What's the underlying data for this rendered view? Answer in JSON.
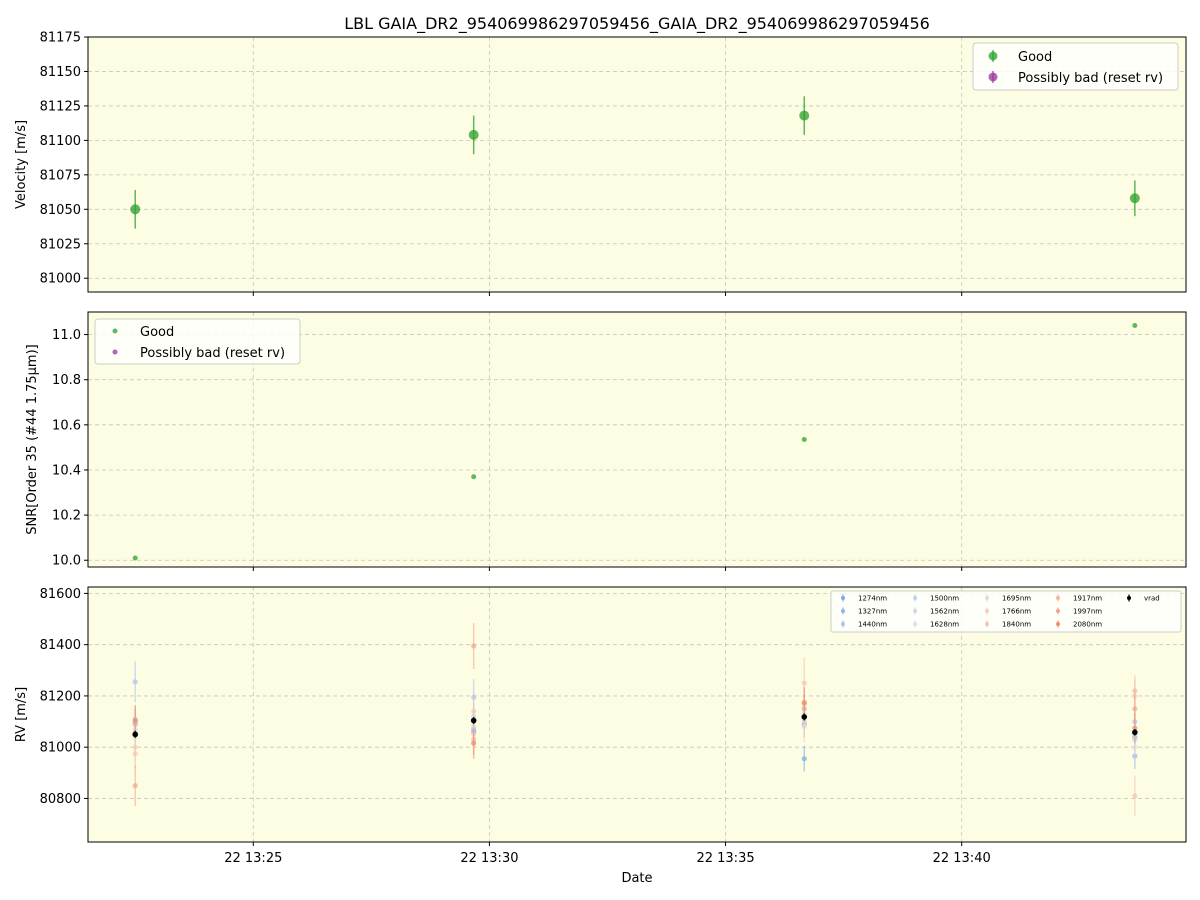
{
  "chart_data": [
    {
      "type": "scatter",
      "title": "LBL GAIA_DR2_954069986297059456_GAIA_DR2_954069986297059456",
      "xlabel": "",
      "ylabel": "Velocity [m/s]",
      "ylim": [
        80990,
        81175
      ],
      "yticks": [
        81000,
        81025,
        81050,
        81075,
        81100,
        81125,
        81150,
        81175
      ],
      "ytick_labels": [
        "81000",
        "81025",
        "81050",
        "81075",
        "81100",
        "81125",
        "81150",
        "81175"
      ],
      "grid": true,
      "legend": "top-right",
      "legend_entries": [
        {
          "label": "Good",
          "color": "#2ca02c"
        },
        {
          "label": "Possibly bad (reset rv)",
          "color": "#9b2f9b"
        }
      ],
      "series": [
        {
          "name": "Good",
          "color": "#2ca02c",
          "points": [
            {
              "x": "13:22:30",
              "y": 81050,
              "err": 14
            },
            {
              "x": "13:29:40",
              "y": 81104,
              "err": 14
            },
            {
              "x": "13:36:40",
              "y": 81118,
              "err": 14
            },
            {
              "x": "13:43:40",
              "y": 81058,
              "err": 13
            }
          ]
        },
        {
          "name": "Possibly bad (reset rv)",
          "color": "#9b2f9b",
          "points": []
        }
      ]
    },
    {
      "type": "scatter",
      "xlabel": "",
      "ylabel": "SNR[Order 35 (#44 1.75μm)]",
      "ylim": [
        9.97,
        11.1
      ],
      "yticks": [
        10.0,
        10.2,
        10.4,
        10.6,
        10.8,
        11.0
      ],
      "ytick_labels": [
        "10.0",
        "10.2",
        "10.4",
        "10.6",
        "10.8",
        "11.0"
      ],
      "grid": true,
      "legend": "top-left",
      "legend_entries": [
        {
          "label": "Good",
          "color": "#2ca02c"
        },
        {
          "label": "Possibly bad (reset rv)",
          "color": "#9b2f9b"
        }
      ],
      "series": [
        {
          "name": "Good",
          "color": "#2ca02c",
          "points": [
            {
              "x": "13:22:30",
              "y": 10.01
            },
            {
              "x": "13:29:40",
              "y": 10.37
            },
            {
              "x": "13:36:40",
              "y": 10.535
            },
            {
              "x": "13:43:40",
              "y": 11.04
            }
          ]
        },
        {
          "name": "Possibly bad (reset rv)",
          "color": "#9b2f9b",
          "points": []
        }
      ]
    },
    {
      "type": "scatter",
      "xlabel": "Date",
      "ylabel": "RV [m/s]",
      "ylim": [
        80630,
        81625
      ],
      "yticks": [
        80800,
        81000,
        81200,
        81400,
        81600
      ],
      "ytick_labels": [
        "80800",
        "81000",
        "81200",
        "81400",
        "81600"
      ],
      "xticks": [
        "13:25:00",
        "13:30:00",
        "13:35:00",
        "13:40:00"
      ],
      "xtick_labels": [
        "22 13:25",
        "22 13:30",
        "22 13:35",
        "22 13:40"
      ],
      "grid": true,
      "legend": "top-right",
      "legend_entries": [
        {
          "label": "1274nm",
          "color": "#7ea6f0"
        },
        {
          "label": "1327nm",
          "color": "#93b4f2"
        },
        {
          "label": "1440nm",
          "color": "#aac3f2"
        },
        {
          "label": "1500nm",
          "color": "#bdd0f0"
        },
        {
          "label": "1562nm",
          "color": "#ccd8ee"
        },
        {
          "label": "1628nm",
          "color": "#d9dfea"
        },
        {
          "label": "1695nm",
          "color": "#e3dcd7"
        },
        {
          "label": "1766nm",
          "color": "#efd0c2"
        },
        {
          "label": "1840nm",
          "color": "#f3c4b0"
        },
        {
          "label": "1917nm",
          "color": "#f4b89c"
        },
        {
          "label": "1997nm",
          "color": "#f2a587"
        },
        {
          "label": "2080nm",
          "color": "#ec8e72"
        },
        {
          "label": "vrad",
          "color": "#000000"
        }
      ],
      "series": [
        {
          "name": "1274nm",
          "color": "#7ea6f0",
          "points": [
            {
              "x": "13:22:30",
              "y": 81100,
              "err": 50
            },
            {
              "x": "13:29:40",
              "y": 81060,
              "err": 50
            },
            {
              "x": "13:36:40",
              "y": 80955,
              "err": 50
            },
            {
              "x": "13:43:40",
              "y": 81040,
              "err": 50
            }
          ]
        },
        {
          "name": "1327nm",
          "color": "#93b4f2",
          "points": [
            {
              "x": "13:22:30",
              "y": 81090,
              "err": 50
            },
            {
              "x": "13:29:40",
              "y": 81070,
              "err": 50
            },
            {
              "x": "13:36:40",
              "y": 81090,
              "err": 50
            },
            {
              "x": "13:43:40",
              "y": 80965,
              "err": 50
            }
          ]
        },
        {
          "name": "1440nm",
          "color": "#aac3f2",
          "points": [
            {
              "x": "13:22:30",
              "y": 81255,
              "err": 80
            },
            {
              "x": "13:29:40",
              "y": 81195,
              "err": 70
            },
            {
              "x": "13:36:40",
              "y": 81150,
              "err": 60
            },
            {
              "x": "13:43:40",
              "y": 81100,
              "err": 60
            }
          ]
        },
        {
          "name": "1500nm",
          "color": "#bdd0f0",
          "points": [
            {
              "x": "13:22:30",
              "y": 81110,
              "err": 50
            },
            {
              "x": "13:29:40",
              "y": 81120,
              "err": 50
            },
            {
              "x": "13:36:40",
              "y": 81100,
              "err": 50
            },
            {
              "x": "13:43:40",
              "y": 81030,
              "err": 50
            }
          ]
        },
        {
          "name": "1562nm",
          "color": "#ccd8ee",
          "points": [
            {
              "x": "13:22:30",
              "y": 81060,
              "err": 50
            },
            {
              "x": "13:29:40",
              "y": 81080,
              "err": 50
            },
            {
              "x": "13:36:40",
              "y": 81120,
              "err": 50
            },
            {
              "x": "13:43:40",
              "y": 81050,
              "err": 50
            }
          ]
        },
        {
          "name": "1628nm",
          "color": "#d9dfea",
          "points": [
            {
              "x": "13:22:30",
              "y": 81040,
              "err": 50
            },
            {
              "x": "13:29:40",
              "y": 81100,
              "err": 50
            },
            {
              "x": "13:36:40",
              "y": 81110,
              "err": 50
            },
            {
              "x": "13:43:40",
              "y": 81070,
              "err": 50
            }
          ]
        },
        {
          "name": "1695nm",
          "color": "#e3dcd7",
          "points": [
            {
              "x": "13:22:30",
              "y": 81070,
              "err": 50
            },
            {
              "x": "13:29:40",
              "y": 81020,
              "err": 50
            },
            {
              "x": "13:36:40",
              "y": 81130,
              "err": 50
            },
            {
              "x": "13:43:40",
              "y": 81000,
              "err": 50
            }
          ]
        },
        {
          "name": "1766nm",
          "color": "#efd0c2",
          "points": [
            {
              "x": "13:22:30",
              "y": 81000,
              "err": 60
            },
            {
              "x": "13:29:40",
              "y": 81050,
              "err": 60
            },
            {
              "x": "13:36:40",
              "y": 81080,
              "err": 60
            },
            {
              "x": "13:43:40",
              "y": 81200,
              "err": 60
            }
          ]
        },
        {
          "name": "1840nm",
          "color": "#f3c4b0",
          "points": [
            {
              "x": "13:22:30",
              "y": 80975,
              "err": 60
            },
            {
              "x": "13:29:40",
              "y": 81140,
              "err": 60
            },
            {
              "x": "13:36:40",
              "y": 81250,
              "err": 100
            },
            {
              "x": "13:43:40",
              "y": 80810,
              "err": 80
            }
          ]
        },
        {
          "name": "1917nm",
          "color": "#f4b89c",
          "points": [
            {
              "x": "13:22:30",
              "y": 81095,
              "err": 60
            },
            {
              "x": "13:29:40",
              "y": 81030,
              "err": 60
            },
            {
              "x": "13:36:40",
              "y": 81150,
              "err": 60
            },
            {
              "x": "13:43:40",
              "y": 81220,
              "err": 60
            }
          ]
        },
        {
          "name": "1997nm",
          "color": "#f2a587",
          "points": [
            {
              "x": "13:22:30",
              "y": 80850,
              "err": 80
            },
            {
              "x": "13:29:40",
              "y": 81395,
              "err": 90
            },
            {
              "x": "13:36:40",
              "y": 81170,
              "err": 60
            },
            {
              "x": "13:43:40",
              "y": 81150,
              "err": 60
            }
          ]
        },
        {
          "name": "2080nm",
          "color": "#ec8e72",
          "points": [
            {
              "x": "13:22:30",
              "y": 81105,
              "err": 60
            },
            {
              "x": "13:29:40",
              "y": 81015,
              "err": 60
            },
            {
              "x": "13:36:40",
              "y": 81175,
              "err": 60
            },
            {
              "x": "13:43:40",
              "y": 81075,
              "err": 60
            }
          ]
        },
        {
          "name": "vrad",
          "color": "#000000",
          "points": [
            {
              "x": "13:22:30",
              "y": 81050,
              "err": 14
            },
            {
              "x": "13:29:40",
              "y": 81104,
              "err": 14
            },
            {
              "x": "13:36:40",
              "y": 81118,
              "err": 14
            },
            {
              "x": "13:43:40",
              "y": 81058,
              "err": 13
            }
          ]
        }
      ]
    }
  ]
}
